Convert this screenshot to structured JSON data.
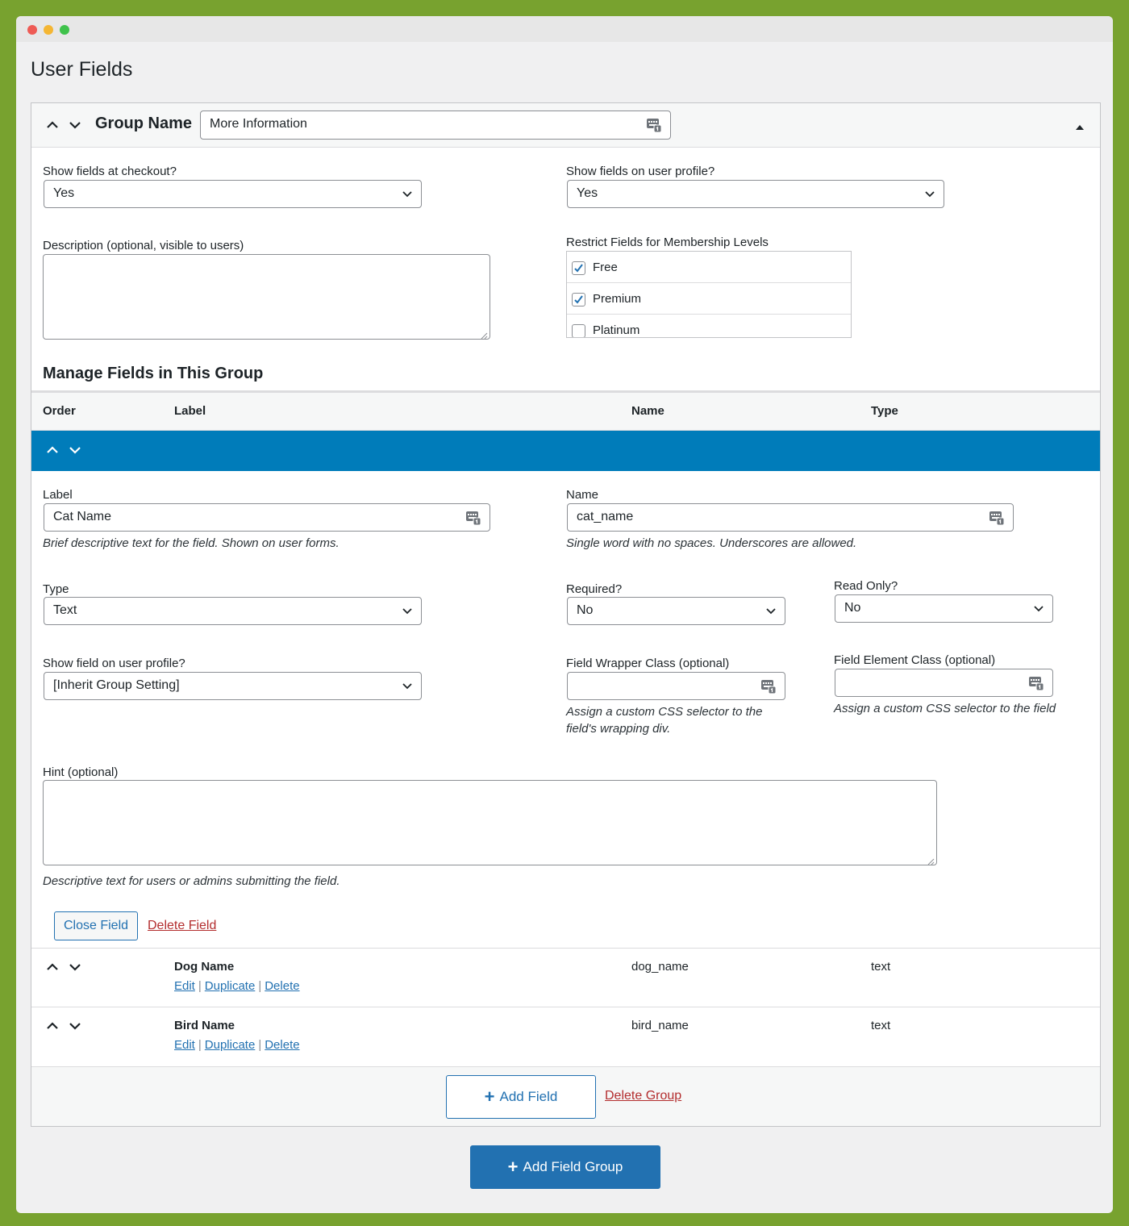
{
  "page": {
    "title": "User Fields"
  },
  "group": {
    "name_label": "Group Name",
    "name_value": "More Information",
    "checkout_label": "Show fields at checkout?",
    "checkout_value": "Yes",
    "profile_label": "Show fields on user profile?",
    "profile_value": "Yes",
    "description_label": "Description (optional, visible to users)",
    "levels_label": "Restrict Fields for Membership Levels",
    "levels": [
      {
        "name": "Free",
        "checked": true
      },
      {
        "name": "Premium",
        "checked": true
      },
      {
        "name": "Platinum",
        "checked": false
      }
    ],
    "manage_title": "Manage Fields in This Group",
    "columns": {
      "order": "Order",
      "label": "Label",
      "name": "Name",
      "type": "Type"
    }
  },
  "field_edit": {
    "label_label": "Label",
    "label_value": "Cat Name",
    "label_help": "Brief descriptive text for the field. Shown on user forms.",
    "name_label": "Name",
    "name_value": "cat_name",
    "name_help": "Single word with no spaces. Underscores are allowed.",
    "type_label": "Type",
    "type_value": "Text",
    "required_label": "Required?",
    "required_value": "No",
    "readonly_label": "Read Only?",
    "readonly_value": "No",
    "profile_label": "Show field on user profile?",
    "profile_value": "[Inherit Group Setting]",
    "wrapper_label": "Field Wrapper Class (optional)",
    "wrapper_help_1": "Assign a custom CSS selector to the",
    "wrapper_help_2": "field's wrapping div.",
    "element_label": "Field Element Class (optional)",
    "element_help": "Assign a custom CSS selector to the field",
    "hint_label": "Hint (optional)",
    "hint_help": "Descriptive text for users or admins submitting the field.",
    "close_button": "Close Field",
    "delete_link": "Delete Field"
  },
  "fields": [
    {
      "label": "Dog Name",
      "name": "dog_name",
      "type": "text"
    },
    {
      "label": "Bird Name",
      "name": "bird_name",
      "type": "text"
    }
  ],
  "row_actions": {
    "edit": "Edit",
    "duplicate": "Duplicate",
    "delete": "Delete",
    "separator": "|"
  },
  "footer": {
    "add_field": "Add Field",
    "delete_group": "Delete Group",
    "add_group": "Add Field Group"
  },
  "colors": {
    "accent": "#2271b1",
    "active_bar": "#007cba",
    "danger": "#b32d2e",
    "frame": "#78a22f"
  }
}
